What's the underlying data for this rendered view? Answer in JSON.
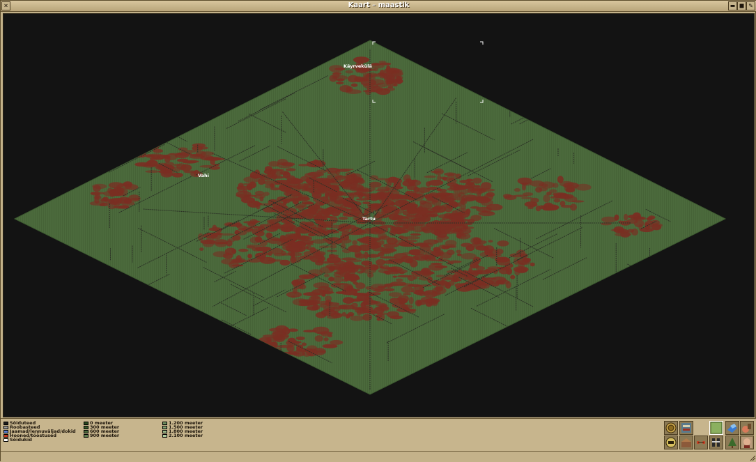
{
  "window": {
    "title": "Kaart – maastik"
  },
  "map": {
    "towns": [
      {
        "name": "Käyrvekülä"
      },
      {
        "name": "Vahi"
      },
      {
        "name": "Tartu"
      }
    ],
    "colors": {
      "background": "#131313",
      "terrain": "#4b6a3c",
      "buildings": "#7a2e22",
      "roads": "#2b3126",
      "viewport_marker": "#ffffff"
    }
  },
  "legend": {
    "transport": [
      {
        "label": "Sõiduteed",
        "color": "#1c1c1c"
      },
      {
        "label": "Roobasteed",
        "color": "#9a9a9a"
      },
      {
        "label": "Jaamad/lennuväljad/dokid",
        "color": "#5a7fd0"
      },
      {
        "label": "Hooned/tööstused",
        "color": "#c83a20"
      },
      {
        "label": "Sõidukid",
        "color": "#ffffff"
      }
    ],
    "heights_low": [
      {
        "label": "0 meeter",
        "color": "#2a4a1e"
      },
      {
        "label": "300 meeter",
        "color": "#3a5a2a"
      },
      {
        "label": "600 meeter",
        "color": "#4b6a3c"
      },
      {
        "label": "900 meeter",
        "color": "#5e7e4e"
      }
    ],
    "heights_high": [
      {
        "label": "1.200 meeter",
        "color": "#6f8f5f"
      },
      {
        "label": "1.500 meeter",
        "color": "#83a272"
      },
      {
        "label": "1.800 meeter",
        "color": "#98b688"
      },
      {
        "label": "2.100 meeter",
        "color": "#aecb9e"
      }
    ]
  },
  "toolbar": {
    "buttons": [
      {
        "name": "show-contours-button",
        "icon": "contour-icon"
      },
      {
        "name": "show-vehicles-button",
        "icon": "vehicles-icon"
      },
      {
        "name": "show-industries-button",
        "icon": "industries-icon"
      },
      {
        "name": "show-terrain-button",
        "icon": "terrain-icon",
        "active": true
      },
      {
        "name": "show-routes-button",
        "icon": "routes-icon"
      },
      {
        "name": "show-vegetation-button",
        "icon": "vegetation-icon"
      },
      {
        "name": "show-owners-button",
        "icon": "owners-icon"
      },
      {
        "name": "toggle-town-names-button",
        "icon": "town-names-icon"
      },
      {
        "name": "center-main-view-button",
        "icon": "center-view-icon"
      },
      {
        "name": "show-link-stats-button",
        "icon": "link-stats-icon"
      },
      {
        "name": "show-trees-button",
        "icon": "trees-icon"
      },
      {
        "name": "show-companies-button",
        "icon": "company-face-icon"
      }
    ]
  }
}
